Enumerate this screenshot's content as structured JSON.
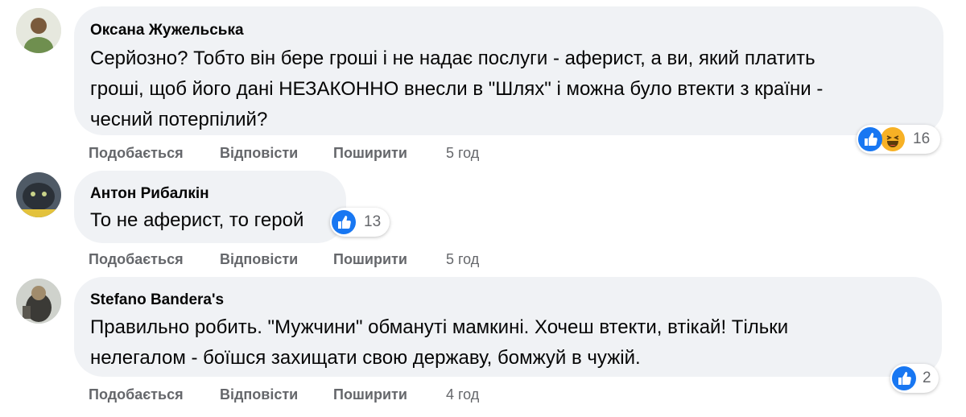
{
  "comments": [
    {
      "author": "Оксана Жужельська",
      "text_lines": [
        "Серйозно? Тобто він бере гроші і не надає послуги - аферист, а ви, який платить",
        "гроші, щоб його дані НЕЗАКОННО внесли в \"Шлях\" і можна було втекти з країни -",
        "чесний потерпілий?"
      ],
      "reactions": [
        "like-icon",
        "haha-icon"
      ],
      "reaction_count": "16",
      "actions": {
        "like": "Подобається",
        "reply": "Відповісти",
        "share": "Поширити",
        "time": "5 год"
      }
    },
    {
      "author": "Антон Рибалкін",
      "text_lines": [
        "То не аферист, то герой"
      ],
      "reactions": [
        "like-icon"
      ],
      "reaction_count": "13",
      "actions": {
        "like": "Подобається",
        "reply": "Відповісти",
        "share": "Поширити",
        "time": "5 год"
      }
    },
    {
      "author": "Stefano Bandera's",
      "text_lines": [
        "Правильно робить. \"Мужчини\" обмануті мамкині. Хочеш втекти, втікай! Тільки",
        "нелегалом - боїшся захищати свою державу, бомжуй в чужій."
      ],
      "reactions": [
        "like-icon"
      ],
      "reaction_count": "2",
      "actions": {
        "like": "Подобається",
        "reply": "Відповісти",
        "share": "Поширити",
        "time": "4 год"
      }
    }
  ],
  "colors": {
    "bubble": "#f0f2f5",
    "action_text": "#65676b",
    "like_blue": "#1877f2",
    "haha_yellow": "#f7b125"
  }
}
